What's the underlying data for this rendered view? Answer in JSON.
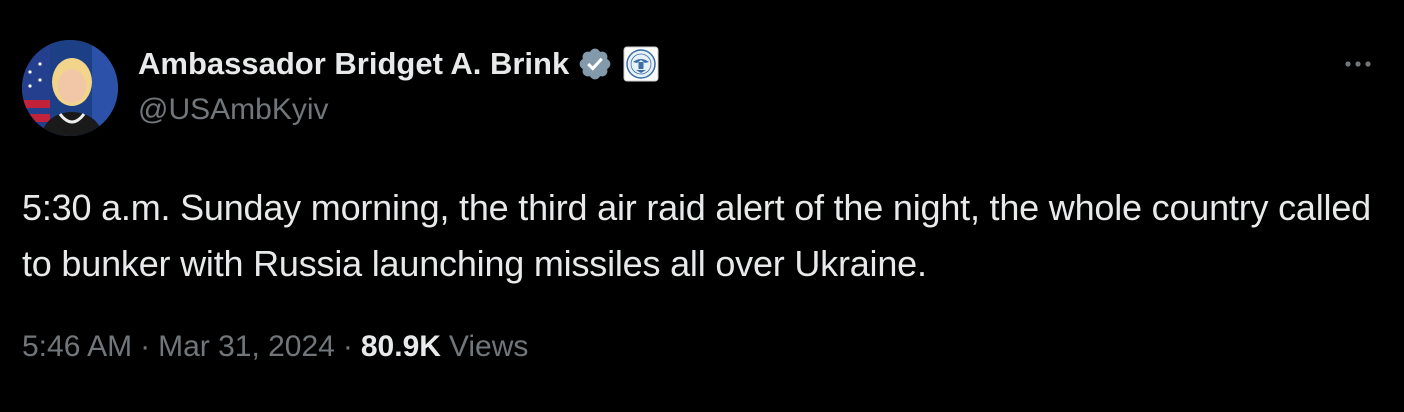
{
  "author": {
    "display_name": "Ambassador Bridget A. Brink",
    "handle": "@USAmbKyiv",
    "verified_icon": "verified-badge-icon",
    "affiliate_icon": "us-state-department-seal-icon"
  },
  "tweet": {
    "text": "5:30 a.m. Sunday morning, the third air raid alert of the night, the whole country called to bunker with Russia launching missiles all over Ukraine."
  },
  "meta": {
    "time": "5:46 AM",
    "separator": "·",
    "date": "Mar 31, 2024",
    "views_count": "80.9K",
    "views_label": "Views"
  },
  "colors": {
    "background": "#000000",
    "primary_text": "#e7e9ea",
    "secondary_text": "#71767b",
    "verified_badge": "#829aab"
  }
}
